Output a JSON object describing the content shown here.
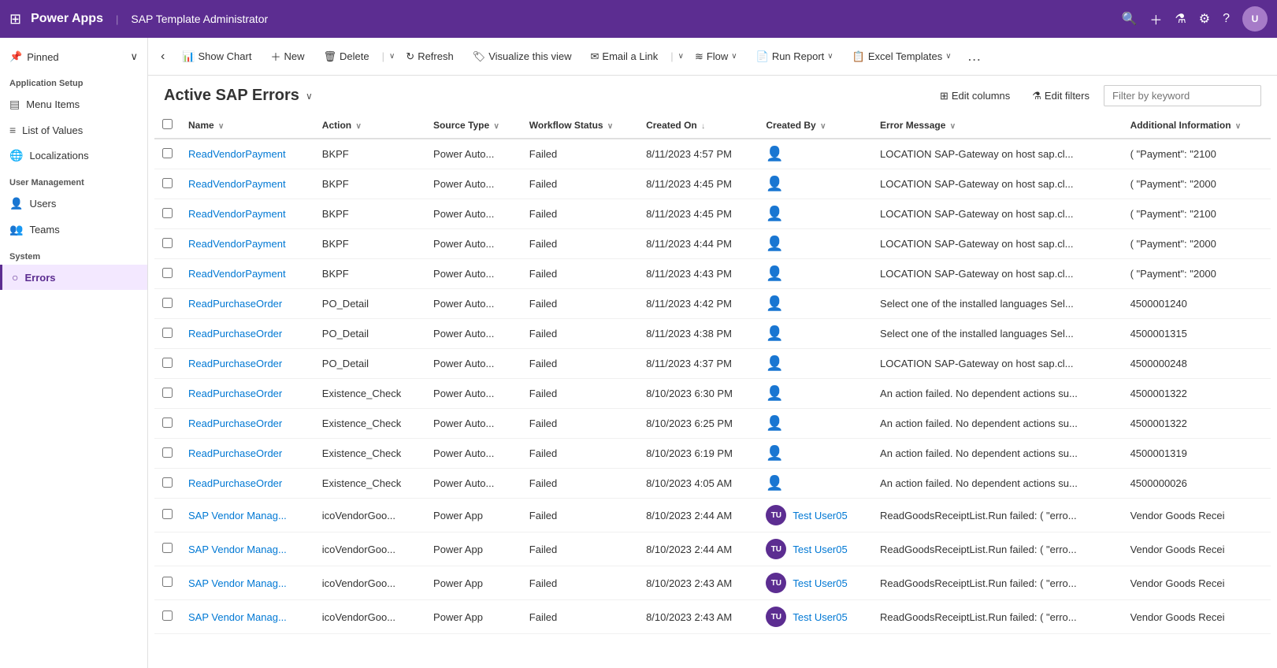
{
  "topNav": {
    "logoText": "Power Apps",
    "separator": "|",
    "appTitle": "SAP Template Administrator",
    "avatarInitials": "U"
  },
  "sidebar": {
    "pinnedLabel": "Pinned",
    "sections": [
      {
        "title": "Application Setup",
        "items": [
          {
            "id": "menu-items",
            "label": "Menu Items",
            "icon": "☰",
            "active": false
          },
          {
            "id": "list-of-values",
            "label": "List of Values",
            "icon": "≡",
            "active": false
          },
          {
            "id": "localizations",
            "label": "Localizations",
            "icon": "🌐",
            "active": false
          }
        ]
      },
      {
        "title": "User Management",
        "items": [
          {
            "id": "users",
            "label": "Users",
            "icon": "👤",
            "active": false
          },
          {
            "id": "teams",
            "label": "Teams",
            "icon": "👥",
            "active": false
          }
        ]
      },
      {
        "title": "System",
        "items": [
          {
            "id": "errors",
            "label": "Errors",
            "icon": "○",
            "active": true
          }
        ]
      }
    ]
  },
  "commandBar": {
    "backLabel": "‹",
    "showChartLabel": "Show Chart",
    "newLabel": "New",
    "deleteLabel": "Delete",
    "refreshLabel": "Refresh",
    "visualizeLabel": "Visualize this view",
    "emailLinkLabel": "Email a Link",
    "flowLabel": "Flow",
    "runReportLabel": "Run Report",
    "excelTemplatesLabel": "Excel Templates"
  },
  "pageHeader": {
    "title": "Active SAP Errors",
    "editColumnsLabel": "Edit columns",
    "editFiltersLabel": "Edit filters",
    "filterPlaceholder": "Filter by keyword"
  },
  "table": {
    "columns": [
      {
        "id": "name",
        "label": "Name"
      },
      {
        "id": "action",
        "label": "Action"
      },
      {
        "id": "sourceType",
        "label": "Source Type"
      },
      {
        "id": "workflowStatus",
        "label": "Workflow Status"
      },
      {
        "id": "createdOn",
        "label": "Created On"
      },
      {
        "id": "createdBy",
        "label": "Created By"
      },
      {
        "id": "errorMessage",
        "label": "Error Message"
      },
      {
        "id": "additionalInfo",
        "label": "Additional Information"
      }
    ],
    "rows": [
      {
        "name": "ReadVendorPayment",
        "action": "BKPF",
        "sourceType": "Power Auto...",
        "workflowStatus": "Failed",
        "createdOn": "8/11/2023 4:57 PM",
        "createdBy": "",
        "createdByAvatar": "",
        "createdByName": "",
        "errorMessage": "LOCATION  SAP-Gateway on host sap.cl...",
        "additionalInfo": "( \"Payment\": \"2100"
      },
      {
        "name": "ReadVendorPayment",
        "action": "BKPF",
        "sourceType": "Power Auto...",
        "workflowStatus": "Failed",
        "createdOn": "8/11/2023 4:45 PM",
        "createdBy": "",
        "createdByAvatar": "",
        "createdByName": "",
        "errorMessage": "LOCATION  SAP-Gateway on host sap.cl...",
        "additionalInfo": "( \"Payment\": \"2000"
      },
      {
        "name": "ReadVendorPayment",
        "action": "BKPF",
        "sourceType": "Power Auto...",
        "workflowStatus": "Failed",
        "createdOn": "8/11/2023 4:45 PM",
        "createdBy": "",
        "createdByAvatar": "",
        "createdByName": "",
        "errorMessage": "LOCATION  SAP-Gateway on host sap.cl...",
        "additionalInfo": "( \"Payment\": \"2100"
      },
      {
        "name": "ReadVendorPayment",
        "action": "BKPF",
        "sourceType": "Power Auto...",
        "workflowStatus": "Failed",
        "createdOn": "8/11/2023 4:44 PM",
        "createdBy": "",
        "createdByAvatar": "",
        "createdByName": "",
        "errorMessage": "LOCATION  SAP-Gateway on host sap.cl...",
        "additionalInfo": "( \"Payment\": \"2000"
      },
      {
        "name": "ReadVendorPayment",
        "action": "BKPF",
        "sourceType": "Power Auto...",
        "workflowStatus": "Failed",
        "createdOn": "8/11/2023 4:43 PM",
        "createdBy": "",
        "createdByAvatar": "",
        "createdByName": "",
        "errorMessage": "LOCATION  SAP-Gateway on host sap.cl...",
        "additionalInfo": "( \"Payment\": \"2000"
      },
      {
        "name": "ReadPurchaseOrder",
        "action": "PO_Detail",
        "sourceType": "Power Auto...",
        "workflowStatus": "Failed",
        "createdOn": "8/11/2023 4:42 PM",
        "createdBy": "",
        "createdByAvatar": "",
        "createdByName": "",
        "errorMessage": "Select one of the installed languages  Sel...",
        "additionalInfo": "4500001240"
      },
      {
        "name": "ReadPurchaseOrder",
        "action": "PO_Detail",
        "sourceType": "Power Auto...",
        "workflowStatus": "Failed",
        "createdOn": "8/11/2023 4:38 PM",
        "createdBy": "",
        "createdByAvatar": "",
        "createdByName": "",
        "errorMessage": "Select one of the installed languages  Sel...",
        "additionalInfo": "4500001315"
      },
      {
        "name": "ReadPurchaseOrder",
        "action": "PO_Detail",
        "sourceType": "Power Auto...",
        "workflowStatus": "Failed",
        "createdOn": "8/11/2023 4:37 PM",
        "createdBy": "",
        "createdByAvatar": "",
        "createdByName": "",
        "errorMessage": "LOCATION  SAP-Gateway on host sap.cl...",
        "additionalInfo": "4500000248"
      },
      {
        "name": "ReadPurchaseOrder",
        "action": "Existence_Check",
        "sourceType": "Power Auto...",
        "workflowStatus": "Failed",
        "createdOn": "8/10/2023 6:30 PM",
        "createdBy": "",
        "createdByAvatar": "",
        "createdByName": "",
        "errorMessage": "An action failed. No dependent actions su...",
        "additionalInfo": "4500001322"
      },
      {
        "name": "ReadPurchaseOrder",
        "action": "Existence_Check",
        "sourceType": "Power Auto...",
        "workflowStatus": "Failed",
        "createdOn": "8/10/2023 6:25 PM",
        "createdBy": "",
        "createdByAvatar": "",
        "createdByName": "",
        "errorMessage": "An action failed. No dependent actions su...",
        "additionalInfo": "4500001322"
      },
      {
        "name": "ReadPurchaseOrder",
        "action": "Existence_Check",
        "sourceType": "Power Auto...",
        "workflowStatus": "Failed",
        "createdOn": "8/10/2023 6:19 PM",
        "createdBy": "",
        "createdByAvatar": "",
        "createdByName": "",
        "errorMessage": "An action failed. No dependent actions su...",
        "additionalInfo": "4500001319"
      },
      {
        "name": "ReadPurchaseOrder",
        "action": "Existence_Check",
        "sourceType": "Power Auto...",
        "workflowStatus": "Failed",
        "createdOn": "8/10/2023 4:05 AM",
        "createdBy": "",
        "createdByAvatar": "",
        "createdByName": "",
        "errorMessage": "An action failed. No dependent actions su...",
        "additionalInfo": "4500000026"
      },
      {
        "name": "SAP Vendor Manag...",
        "action": "icoVendorGoo...",
        "sourceType": "Power App",
        "workflowStatus": "Failed",
        "createdOn": "8/10/2023 2:44 AM",
        "createdBy": "TU",
        "createdByAvatar": "TU",
        "createdByName": "Test User05",
        "errorMessage": "ReadGoodsReceiptList.Run failed: ( \"erro...",
        "additionalInfo": "Vendor Goods Recei"
      },
      {
        "name": "SAP Vendor Manag...",
        "action": "icoVendorGoo...",
        "sourceType": "Power App",
        "workflowStatus": "Failed",
        "createdOn": "8/10/2023 2:44 AM",
        "createdBy": "TU",
        "createdByAvatar": "TU",
        "createdByName": "Test User05",
        "errorMessage": "ReadGoodsReceiptList.Run failed: ( \"erro...",
        "additionalInfo": "Vendor Goods Recei"
      },
      {
        "name": "SAP Vendor Manag...",
        "action": "icoVendorGoo...",
        "sourceType": "Power App",
        "workflowStatus": "Failed",
        "createdOn": "8/10/2023 2:43 AM",
        "createdBy": "TU",
        "createdByAvatar": "TU",
        "createdByName": "Test User05",
        "errorMessage": "ReadGoodsReceiptList.Run failed: ( \"erro...",
        "additionalInfo": "Vendor Goods Recei"
      },
      {
        "name": "SAP Vendor Manag...",
        "action": "icoVendorGoo...",
        "sourceType": "Power App",
        "workflowStatus": "Failed",
        "createdOn": "8/10/2023 2:43 AM",
        "createdBy": "TU",
        "createdByAvatar": "TU",
        "createdByName": "Test User05",
        "errorMessage": "ReadGoodsReceiptList.Run failed: ( \"erro...",
        "additionalInfo": "Vendor Goods Recei"
      }
    ]
  }
}
